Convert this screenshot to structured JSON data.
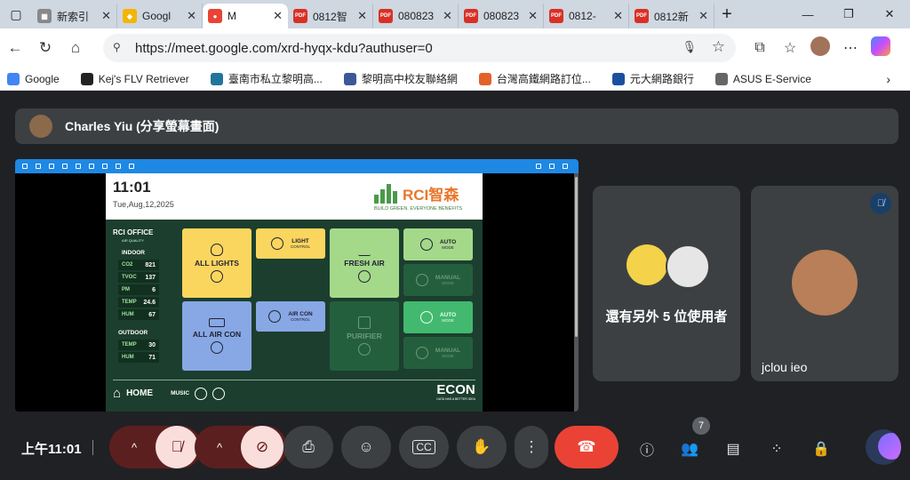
{
  "browser": {
    "tabs": [
      {
        "label": "新索引",
        "color": "#888888",
        "glyph": "▦",
        "active": false
      },
      {
        "label": "Googl",
        "color": "#f5b400",
        "glyph": "◆",
        "active": false
      },
      {
        "label": "M",
        "color": "#ea4335",
        "glyph": "●",
        "active": true
      },
      {
        "label": "0812智",
        "color": "#d93025",
        "glyph": "PDF",
        "active": false
      },
      {
        "label": "080823",
        "color": "#d93025",
        "glyph": "PDF",
        "active": false
      },
      {
        "label": "080823",
        "color": "#d93025",
        "glyph": "PDF",
        "active": false
      },
      {
        "label": "0812-",
        "color": "#d93025",
        "glyph": "PDF",
        "active": false
      },
      {
        "label": "0812新",
        "color": "#d93025",
        "glyph": "PDF",
        "active": false
      }
    ],
    "new_tab": "+",
    "window_controls": {
      "minimize": "—",
      "restore": "❐",
      "close": "✕"
    },
    "url": "https://meet.google.com/xrd-hyqx-kdu?authuser=0",
    "bookmarks": [
      {
        "label": "Google",
        "color": "#4285f4"
      },
      {
        "label": "Kej's FLV Retriever",
        "color": "#222222"
      },
      {
        "label": "臺南市私立黎明高...",
        "color": "#21759b"
      },
      {
        "label": "黎明高中校友聯絡網",
        "color": "#3b5998"
      },
      {
        "label": "台灣高鐵網路訂位...",
        "color": "#e2622a"
      },
      {
        "label": "元大網路銀行",
        "color": "#1a4fa0"
      },
      {
        "label": "ASUS E-Service",
        "color": "#666666"
      }
    ]
  },
  "meet": {
    "presenter": "Charles Yiu (分享螢幕畫面)",
    "others_count_label": "還有另外 5 位使用者",
    "participant_name": "jclou ieo",
    "time": "上午11:01",
    "participants_badge": "7"
  },
  "shared_screen": {
    "clock": "11:01",
    "date": "Tue,Aug,12,2025",
    "brand": "RCI智森",
    "brand_tagline": "BUILD GREEN. EVERYONE BENEFITS",
    "office": "RCI OFFICE",
    "air_quality": "AIR QUALITY",
    "indoor_label": "INDOOR",
    "indoor": [
      {
        "k": "CO2",
        "v": "821"
      },
      {
        "k": "TVOC",
        "v": "137"
      },
      {
        "k": "PM",
        "v": "6"
      },
      {
        "k": "TEMP",
        "v": "24.6"
      },
      {
        "k": "HUM",
        "v": "67"
      }
    ],
    "outdoor_label": "OUTDOOR",
    "outdoor": [
      {
        "k": "TEMP",
        "v": "30"
      },
      {
        "k": "HUM",
        "v": "71"
      }
    ],
    "tiles": {
      "all_lights": "ALL LIGHTS",
      "light_control": "LIGHT",
      "light_control_sub": "CONTROL",
      "fresh_air": "FRESH AIR",
      "auto_mode": "AUTO",
      "auto_mode_sub": "MODE",
      "manual_mode": "MANUAL",
      "manual_mode_sub": "MODE",
      "all_air_con": "ALL AIR CON",
      "air_con_control": "AIR CON",
      "air_con_control_sub": "CONTROL",
      "purifier": "PURIFIER",
      "auto_mode_2": "AUTO",
      "auto_mode_2_sub": "MODE",
      "manual_mode_2": "MANUAL",
      "manual_mode_2_sub": "MODE"
    },
    "home": "HOME",
    "music": "MUSIC",
    "econ": "ECON",
    "econ_tagline": "DATA HAS A BETTER IDEA"
  },
  "colors": {
    "hangup": "#ea4335",
    "muted_bg": "#f9dedc",
    "meet_bg": "#202124",
    "tile_bg": "#3c4043"
  }
}
